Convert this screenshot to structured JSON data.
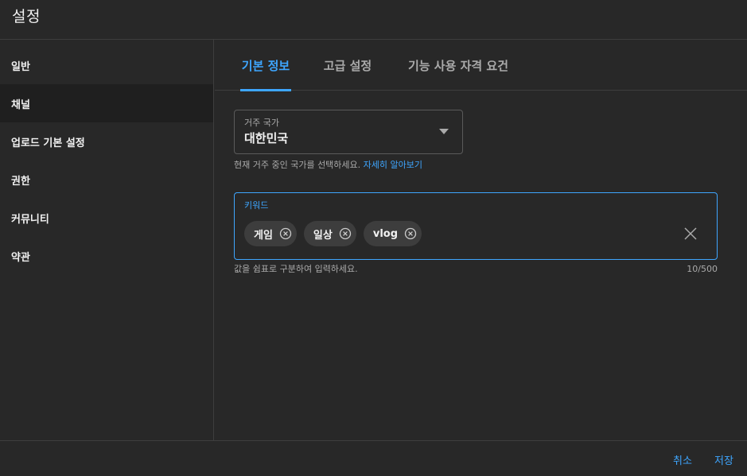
{
  "header": {
    "title": "설정"
  },
  "sidebar": {
    "items": [
      {
        "label": "일반"
      },
      {
        "label": "채널",
        "active": true
      },
      {
        "label": "업로드 기본 설정"
      },
      {
        "label": "권한"
      },
      {
        "label": "커뮤니티"
      },
      {
        "label": "약관"
      }
    ]
  },
  "tabs": [
    {
      "label": "기본 정보",
      "active": true
    },
    {
      "label": "고급 설정"
    },
    {
      "label": "기능 사용 자격 요건"
    }
  ],
  "country": {
    "label": "거주 국가",
    "value": "대한민국",
    "helper": "현재 거주 중인 국가를 선택하세요.",
    "learn_more": "자세히 알아보기"
  },
  "keywords": {
    "label": "키워드",
    "chips": [
      "게임",
      "일상",
      "vlog"
    ],
    "helper": "값을 쉼표로 구분하여 입력하세요.",
    "counter": "10/500"
  },
  "footer": {
    "cancel_label": "취소",
    "save_label": "저장"
  },
  "colors": {
    "accent": "#3ea6ff",
    "background": "#282828",
    "sidebar_active": "#1f1f1f",
    "chip": "#3d3d3d"
  },
  "icons": {
    "dropdown": "caret-down-icon",
    "chip_remove": "remove-circle-icon",
    "clear": "close-icon"
  }
}
